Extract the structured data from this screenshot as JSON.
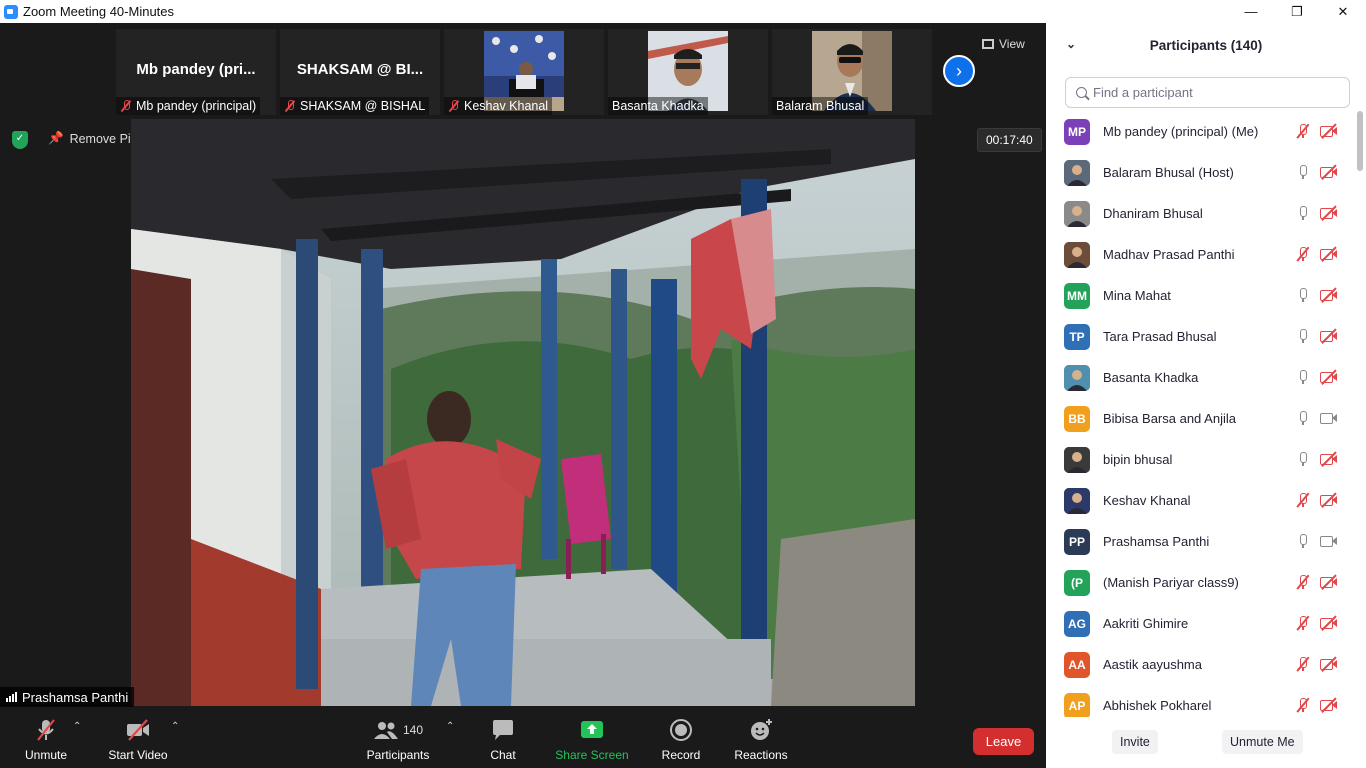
{
  "window": {
    "title": "Zoom Meeting 40-Minutes",
    "minimize": "—",
    "maximize": "❐",
    "close": "✕"
  },
  "strip": {
    "tiles": [
      {
        "big_name": "Mb pandey (pri...",
        "caption": "Mb pandey (principal)",
        "muted": true
      },
      {
        "big_name": "SHAKSAM @ BI...",
        "caption": "SHAKSAM @ BISHAL",
        "muted": true
      },
      {
        "big_name": "",
        "caption": "Keshav Khanal",
        "muted": true
      },
      {
        "big_name": "",
        "caption": "Basanta Khadka",
        "muted": false
      },
      {
        "big_name": "",
        "caption": "Balaram Bhusal",
        "muted": false
      }
    ],
    "next_arrow": "›",
    "view_label": "View"
  },
  "meeting": {
    "remove_pin": "Remove Pin",
    "timer": "00:17:40",
    "pinned_name": "Prashamsa Panthi"
  },
  "toolbar": {
    "unmute": "Unmute",
    "start_video": "Start Video",
    "participants": "Participants",
    "participants_count": "140",
    "chat": "Chat",
    "share_screen": "Share Screen",
    "record": "Record",
    "reactions": "Reactions",
    "leave": "Leave",
    "caret": "⌃"
  },
  "panel": {
    "title": "Participants (140)",
    "collapse": "⌄",
    "search_placeholder": "Find a participant",
    "participants": [
      {
        "initials": "MP",
        "color": "#7b3fb8",
        "name": "Mb pandey (principal) (Me)",
        "mic_off": true,
        "cam_off": true,
        "photo": false
      },
      {
        "initials": "",
        "color": "#5a6a7a",
        "name": "Balaram Bhusal (Host)",
        "mic_off": false,
        "cam_off": true,
        "photo": true
      },
      {
        "initials": "",
        "color": "#8a8a8a",
        "name": "Dhaniram Bhusal",
        "mic_off": false,
        "cam_off": true,
        "photo": true
      },
      {
        "initials": "",
        "color": "#6b4d3a",
        "name": "Madhav Prasad Panthi",
        "mic_off": true,
        "cam_off": true,
        "photo": true
      },
      {
        "initials": "MM",
        "color": "#23a35a",
        "name": "Mina Mahat",
        "mic_off": false,
        "cam_off": true,
        "photo": false
      },
      {
        "initials": "TP",
        "color": "#2f6fb5",
        "name": "Tara Prasad Bhusal",
        "mic_off": false,
        "cam_off": true,
        "photo": false
      },
      {
        "initials": "",
        "color": "#4f8fb0",
        "name": "Basanta Khadka",
        "mic_off": false,
        "cam_off": true,
        "photo": true
      },
      {
        "initials": "BB",
        "color": "#f0a01e",
        "name": "Bibisa Barsa and Anjila",
        "mic_off": false,
        "cam_off": false,
        "photo": false
      },
      {
        "initials": "",
        "color": "#3a3a3a",
        "name": "bipin bhusal",
        "mic_off": false,
        "cam_off": true,
        "photo": true
      },
      {
        "initials": "",
        "color": "#2c3a6b",
        "name": "Keshav Khanal",
        "mic_off": true,
        "cam_off": true,
        "photo": true
      },
      {
        "initials": "PP",
        "color": "#2b3b55",
        "name": "Prashamsa Panthi",
        "mic_off": false,
        "cam_off": false,
        "photo": false
      },
      {
        "initials": "(P",
        "color": "#23a35a",
        "name": "(Manish Pariyar class9)",
        "mic_off": true,
        "cam_off": true,
        "photo": false
      },
      {
        "initials": "AG",
        "color": "#2f6fb5",
        "name": "Aakriti Ghimire",
        "mic_off": true,
        "cam_off": true,
        "photo": false
      },
      {
        "initials": "AA",
        "color": "#e0552a",
        "name": "Aastik aayushma",
        "mic_off": true,
        "cam_off": true,
        "photo": false
      },
      {
        "initials": "AP",
        "color": "#f0a01e",
        "name": "Abhishek Pokharel",
        "mic_off": true,
        "cam_off": true,
        "photo": false
      }
    ],
    "invite": "Invite",
    "unmute_me": "Unmute Me"
  }
}
